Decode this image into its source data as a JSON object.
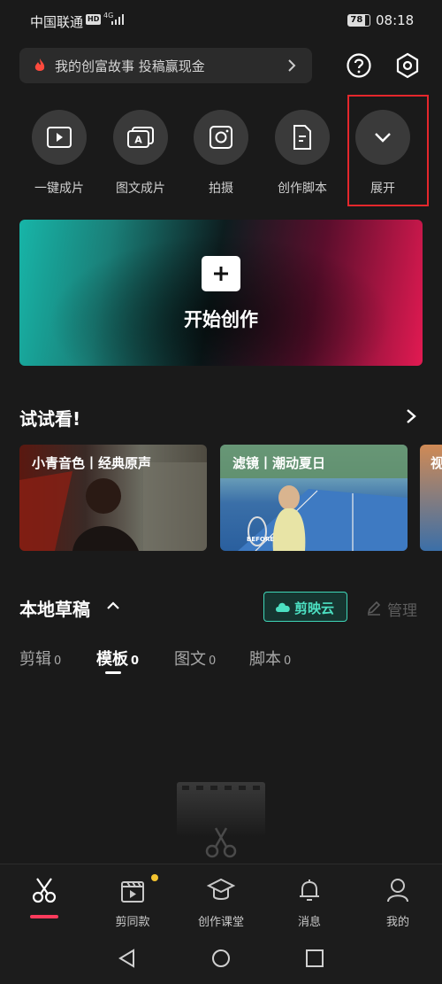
{
  "status": {
    "carrier": "中国联通",
    "hd": "HD",
    "network": "4G",
    "battery": "78",
    "time": "08:18"
  },
  "banner": {
    "text": "我的创富故事 投稿赢现金"
  },
  "top_icons": [
    "help-icon",
    "settings-icon"
  ],
  "quick_actions": [
    {
      "label": "一键成片",
      "icon": "play-video-icon"
    },
    {
      "label": "图文成片",
      "icon": "text-to-video-icon"
    },
    {
      "label": "拍摄",
      "icon": "camera-icon"
    },
    {
      "label": "创作脚本",
      "icon": "script-icon"
    },
    {
      "label": "展开",
      "icon": "chevron-down-icon"
    }
  ],
  "create": {
    "label": "开始创作"
  },
  "try": {
    "title": "试试看!",
    "cards": [
      {
        "label": "小青音色丨经典原声"
      },
      {
        "label": "滤镜丨潮动夏日",
        "tag": "BEFORE"
      },
      {
        "label": "视"
      }
    ]
  },
  "drafts": {
    "title": "本地草稿",
    "cloud": "剪映云",
    "manage": "管理",
    "tabs": [
      {
        "label": "剪辑",
        "count": "0"
      },
      {
        "label": "模板",
        "count": "0"
      },
      {
        "label": "图文",
        "count": "0"
      },
      {
        "label": "脚本",
        "count": "0"
      }
    ]
  },
  "nav": [
    {
      "label": "",
      "icon": "scissors-icon"
    },
    {
      "label": "剪同款",
      "icon": "template-clapper-icon"
    },
    {
      "label": "创作课堂",
      "icon": "graduation-cap-icon"
    },
    {
      "label": "消息",
      "icon": "bell-icon"
    },
    {
      "label": "我的",
      "icon": "user-icon"
    }
  ],
  "colors": {
    "accent_red": "#ff3b5c",
    "cloud_teal": "#3fd6b8",
    "highlight_box": "#e5272c"
  }
}
